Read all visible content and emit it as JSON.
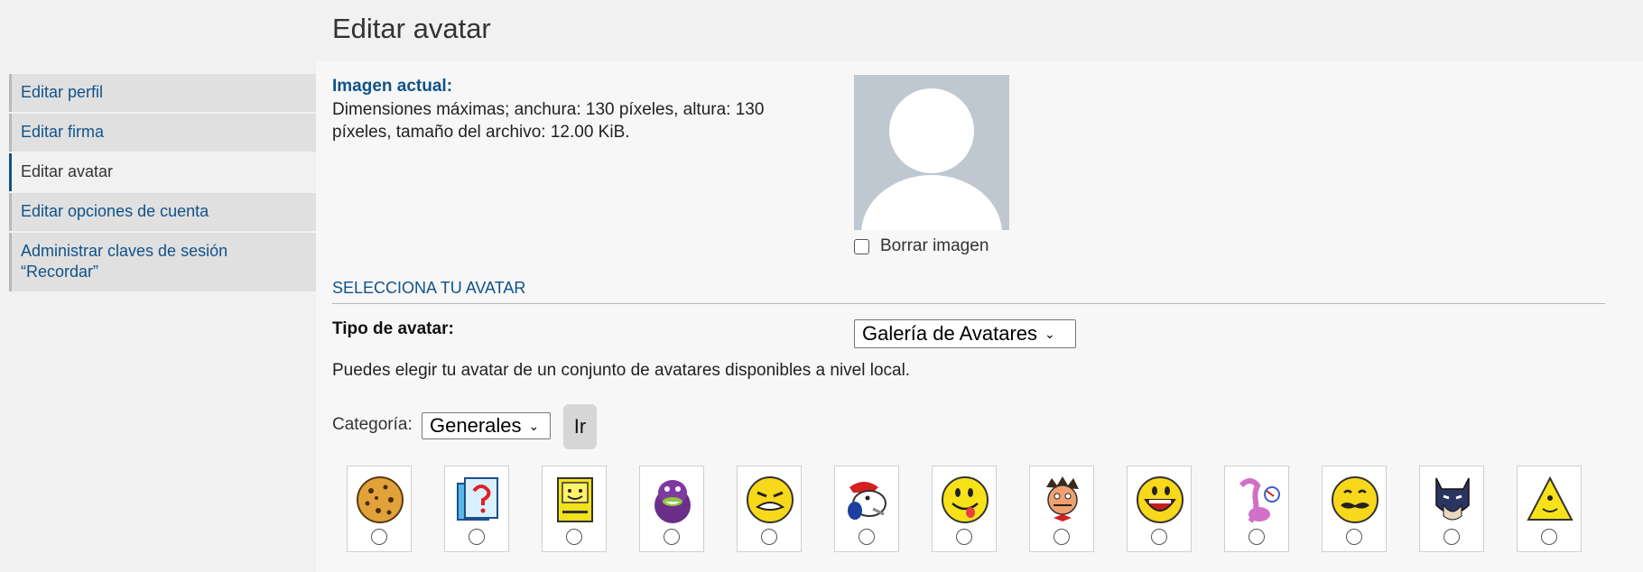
{
  "page": {
    "title": "Editar avatar"
  },
  "sidebar": {
    "items": [
      {
        "label": "Editar perfil"
      },
      {
        "label": "Editar firma"
      },
      {
        "label": "Editar avatar"
      },
      {
        "label": "Editar opciones de cuenta"
      },
      {
        "label": "Administrar claves de sesión “Recordar”"
      }
    ]
  },
  "current": {
    "label": "Imagen actual:",
    "description": "Dimensiones máximas; anchura: 130 píxeles, altura: 130 píxeles, tamaño del archivo: 12.00 KiB.",
    "delete_label": "Borrar imagen"
  },
  "select_section": {
    "title": "SELECCIONA TU AVATAR",
    "type_label": "Tipo de avatar:",
    "type_value": "Galería de Avatares",
    "description": "Puedes elegir tu avatar de un conjunto de avatares disponibles a nivel local.",
    "category_label": "Categoría:",
    "category_value": "Generales",
    "go_label": "Ir"
  },
  "gallery": {
    "avatars": [
      {
        "icon": "cookie-face-icon"
      },
      {
        "icon": "question-mark-icon"
      },
      {
        "icon": "computer-face-icon"
      },
      {
        "icon": "purple-dinosaur-icon"
      },
      {
        "icon": "grimace-smiley-icon"
      },
      {
        "icon": "cartoon-dog-icon"
      },
      {
        "icon": "tongue-smiley-icon"
      },
      {
        "icon": "cartoon-man-icon"
      },
      {
        "icon": "laughing-smiley-icon"
      },
      {
        "icon": "pink-panther-icon"
      },
      {
        "icon": "mustache-smiley-icon"
      },
      {
        "icon": "batman-icon"
      },
      {
        "icon": "triangle-smiley-icon"
      }
    ]
  },
  "colors": {
    "link": "#105289",
    "panel_bg": "#f7f7f7",
    "sidebar_bg": "#e0e0e0",
    "avatar_placeholder": "#bfc8d0"
  }
}
